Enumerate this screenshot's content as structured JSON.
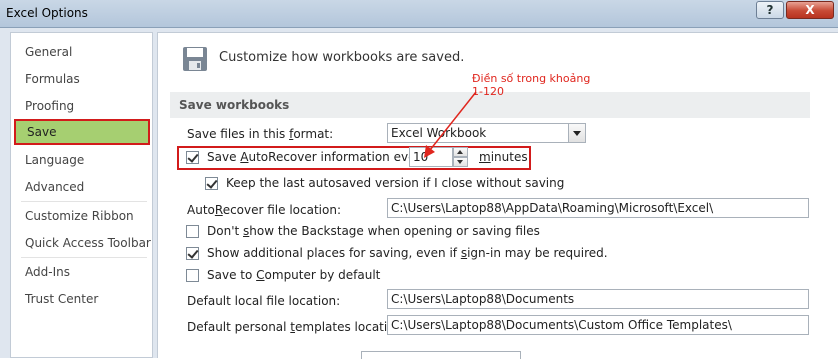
{
  "window": {
    "title": "Excel Options",
    "help_label": "?",
    "close_label": "X"
  },
  "sidebar": {
    "items": [
      {
        "label": "General"
      },
      {
        "label": "Formulas"
      },
      {
        "label": "Proofing"
      },
      {
        "label": "Save"
      },
      {
        "label": "Language"
      },
      {
        "label": "Advanced"
      },
      {
        "label": "Customize Ribbon"
      },
      {
        "label": "Quick Access Toolbar"
      },
      {
        "label": "Add-Ins"
      },
      {
        "label": "Trust Center"
      }
    ],
    "selected": "Save"
  },
  "content": {
    "header": "Customize how workbooks are saved.",
    "section_title": "Save workbooks",
    "save_format": {
      "label_before": "Save files in this ",
      "label_u": "f",
      "label_after": "ormat:",
      "value": "Excel Workbook"
    },
    "autorecover": {
      "checked": true,
      "label_before": "Save ",
      "label_u": "A",
      "label_after": "utoRecover information every",
      "minutes_value": "10",
      "minutes_label_u": "m",
      "minutes_label_after": "inutes"
    },
    "keep_last": {
      "checked": true,
      "label": "Keep the last autosaved version if I close without saving"
    },
    "autorecover_location": {
      "label_before": "Auto",
      "label_u": "R",
      "label_after": "ecover file location:",
      "value": "C:\\Users\\Laptop88\\AppData\\Roaming\\Microsoft\\Excel\\"
    },
    "backstage": {
      "checked": false,
      "label_before": "Don't ",
      "label_u": "s",
      "label_after": "how the Backstage when opening or saving files"
    },
    "additional_places": {
      "checked": true,
      "label_before": "Show additional places for saving, even if ",
      "label_u": "s",
      "label_after": "ign-in may be required."
    },
    "save_to_computer": {
      "checked": false,
      "label_before": "Save to ",
      "label_u": "C",
      "label_after": "omputer by default"
    },
    "default_local": {
      "label_before": "Default local f",
      "label_u": "i",
      "label_after": "le location:",
      "value": "C:\\Users\\Laptop88\\Documents"
    },
    "personal_templates": {
      "label_before": "Default personal ",
      "label_u": "t",
      "label_after": "emplates location:",
      "value": "C:\\Users\\Laptop88\\Documents\\Custom Office Templates\\"
    }
  },
  "annotation": {
    "text": "Điền số trong khoảng 1-120",
    "color": "#e0261e"
  },
  "colors": {
    "selected_nav": "#a6cf71",
    "highlight": "#d21b1b",
    "dialog_bg": "#dfe6ef"
  },
  "icons": [
    "floppy-disk-icon",
    "checkbox-check-icon",
    "dropdown-arrow-icon",
    "spin-up-icon",
    "spin-down-icon"
  ]
}
